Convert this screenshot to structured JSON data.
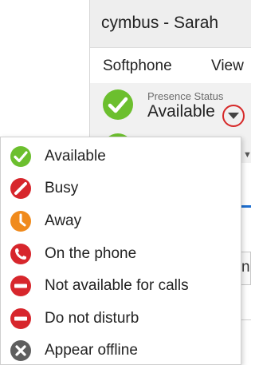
{
  "window": {
    "title": "cymbus - Sarah"
  },
  "menu_bar": {
    "items": [
      {
        "label": "Softphone"
      },
      {
        "label": "View"
      }
    ]
  },
  "presence": {
    "caption": "Presence Status",
    "value": "Available",
    "icon": "check-circle-icon",
    "dropdown_icon": "chevron-down-icon"
  },
  "status_menu": {
    "items": [
      {
        "label": "Available",
        "icon": "check-circle-icon",
        "color": "#6cbf2e"
      },
      {
        "label": "Busy",
        "icon": "busy-slash-icon",
        "color": "#d7262c"
      },
      {
        "label": "Away",
        "icon": "clock-icon",
        "color": "#f08a1c"
      },
      {
        "label": "On the phone",
        "icon": "phone-icon",
        "color": "#d7262c"
      },
      {
        "label": "Not available for calls",
        "icon": "minus-circle-icon",
        "color": "#d7262c"
      },
      {
        "label": "Do not disturb",
        "icon": "minus-circle-icon",
        "color": "#d7262c"
      },
      {
        "label": "Appear offline",
        "icon": "x-circle-icon",
        "color": "#5f5f5f"
      }
    ]
  },
  "background_peek": {
    "box_char": "n"
  },
  "colors": {
    "available": "#6cbf2e",
    "busy": "#d7262c",
    "away": "#f08a1c",
    "offline": "#5f5f5f",
    "accent": "#1e6fd0"
  }
}
